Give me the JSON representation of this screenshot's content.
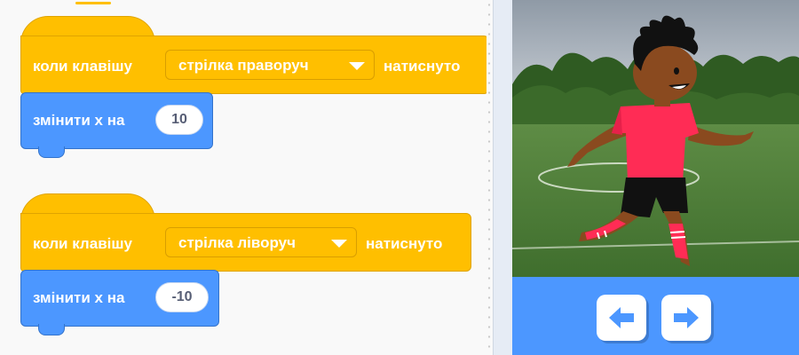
{
  "scripts": [
    {
      "hat": {
        "prefix": "коли клавішу",
        "key_dropdown": "стрілка праворуч",
        "suffix": "натиснуто"
      },
      "command": {
        "label": "змінити x на",
        "value": "10"
      }
    },
    {
      "hat": {
        "prefix": "коли клавішу",
        "key_dropdown": "стрілка ліворуч",
        "suffix": "натиснуто"
      },
      "command": {
        "label": "змінити x на",
        "value": "-10"
      }
    }
  ],
  "stage": {
    "sprite": "soccer-player",
    "backdrop": "soccer-field"
  },
  "controls": {
    "left_icon": "arrow-left-icon",
    "right_icon": "arrow-right-icon"
  },
  "colors": {
    "event": "#ffbf00",
    "motion": "#4c97ff",
    "controls_bg": "#4c97ff",
    "arrow": "#4c97ff"
  }
}
